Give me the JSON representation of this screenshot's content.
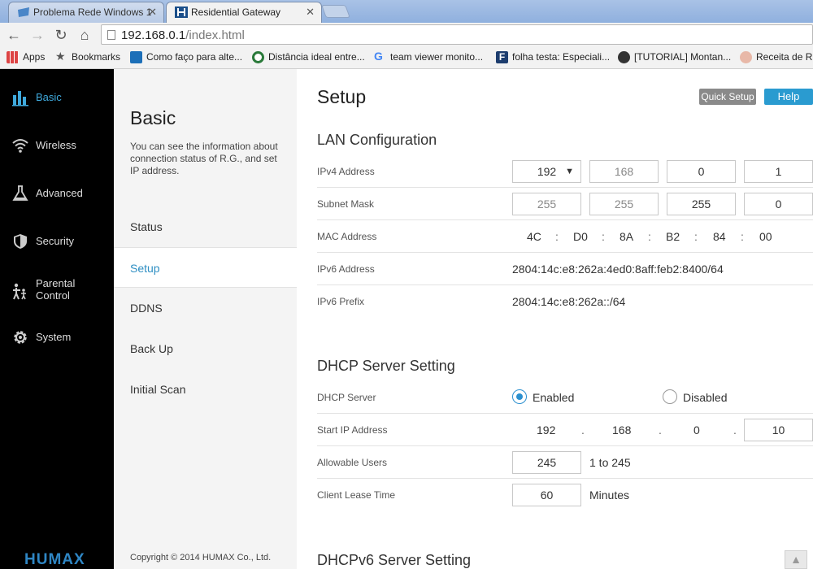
{
  "browser": {
    "tabs": [
      {
        "title": "Problema Rede Windows 1",
        "active": false
      },
      {
        "title": "Residential Gateway",
        "active": true
      }
    ],
    "url_host": "192.168.0.1",
    "url_path": "/index.html",
    "bookmarks": [
      {
        "label": "Apps",
        "icon": "apps-grid-icon"
      },
      {
        "label": "Bookmarks",
        "icon": "star-icon"
      },
      {
        "label": "Como faço para alte...",
        "icon": "net-icon"
      },
      {
        "label": "Distância ideal entre...",
        "icon": "site-icon"
      },
      {
        "label": "team viewer monito...",
        "icon": "google-icon"
      },
      {
        "label": "folha testa: Especiali...",
        "icon": "folha-icon"
      },
      {
        "label": "[TUTORIAL] Montan...",
        "icon": "forum-icon"
      },
      {
        "label": "Receita de Ris",
        "icon": "recipe-icon"
      }
    ]
  },
  "sidebar": {
    "items": [
      {
        "label": "Basic",
        "icon": "bar-chart-icon",
        "active": true
      },
      {
        "label": "Wireless",
        "icon": "wifi-icon",
        "active": false
      },
      {
        "label": "Advanced",
        "icon": "flask-icon",
        "active": false
      },
      {
        "label": "Security",
        "icon": "shield-icon",
        "active": false
      },
      {
        "label": "Parental Control",
        "icon": "parent-child-icon",
        "active": false
      },
      {
        "label": "System",
        "icon": "gear-icon",
        "active": false
      }
    ],
    "brand": "HUMAX"
  },
  "submenu": {
    "title": "Basic",
    "description": "You can see the information about connection status of R.G., and set IP address.",
    "items": [
      {
        "label": "Status",
        "active": false
      },
      {
        "label": "Setup",
        "active": true
      },
      {
        "label": "DDNS",
        "active": false
      },
      {
        "label": "Back Up",
        "active": false
      },
      {
        "label": "Initial Scan",
        "active": false
      }
    ],
    "copyright": "Copyright © 2014 HUMAX Co., Ltd."
  },
  "main": {
    "title": "Setup",
    "quick_setup_label": "Quick Setup",
    "help_label": "Help",
    "lan": {
      "title": "LAN Configuration",
      "ipv4_label": "IPv4 Address",
      "ipv4": [
        "192",
        "168",
        "0",
        "1"
      ],
      "subnet_label": "Subnet Mask",
      "subnet": [
        "255",
        "255",
        "255",
        "0"
      ],
      "mac_label": "MAC Address",
      "mac": [
        "4C",
        "D0",
        "8A",
        "B2",
        "84",
        "00"
      ],
      "mac_sep": ":",
      "ipv6_label": "IPv6 Address",
      "ipv6": "2804:14c:e8:262a:4ed0:8aff:feb2:8400/64",
      "prefix_label": "IPv6 Prefix",
      "prefix": "2804:14c:e8:262a::/64"
    },
    "dhcp": {
      "title": "DHCP Server Setting",
      "server_label": "DHCP Server",
      "enabled_label": "Enabled",
      "disabled_label": "Disabled",
      "selected": "Enabled",
      "start_label": "Start IP Address",
      "start_ip": [
        "192",
        "168",
        "0",
        "10"
      ],
      "ip_sep": ".",
      "users_label": "Allowable Users",
      "users_value": "245",
      "users_range": "1 to 245",
      "lease_label": "Client Lease Time",
      "lease_value": "60",
      "lease_unit": "Minutes"
    },
    "dhcpv6": {
      "title": "DHCPv6 Server Setting"
    }
  }
}
